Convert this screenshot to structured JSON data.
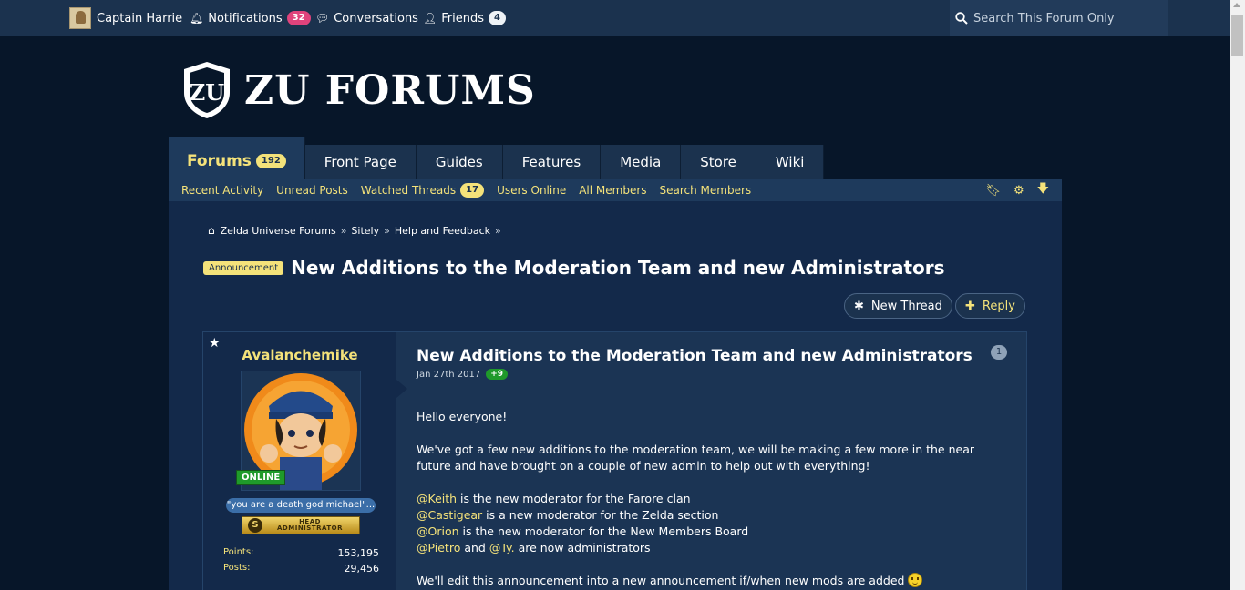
{
  "topbar": {
    "user": "Captain Harrie",
    "notifications_label": "Notifications",
    "notifications_count": "32",
    "conversations_label": "Conversations",
    "friends_label": "Friends",
    "friends_count": "4",
    "search_placeholder": "Search This Forum Only"
  },
  "logo": {
    "mark": "ZU",
    "text": "ZU FORUMS"
  },
  "nav": {
    "tabs": [
      {
        "label": "Forums",
        "count": "192"
      },
      {
        "label": "Front Page"
      },
      {
        "label": "Guides"
      },
      {
        "label": "Features"
      },
      {
        "label": "Media"
      },
      {
        "label": "Store"
      },
      {
        "label": "Wiki"
      }
    ],
    "sub": [
      {
        "label": "Recent Activity"
      },
      {
        "label": "Unread Posts"
      },
      {
        "label": "Watched Threads",
        "count": "17"
      },
      {
        "label": "Users Online"
      },
      {
        "label": "All Members"
      },
      {
        "label": "Search Members"
      }
    ]
  },
  "breadcrumb": [
    "Zelda Universe Forums",
    "Sitely",
    "Help and Feedback"
  ],
  "thread": {
    "prefix": "Announcement",
    "title": "New Additions to the Moderation Team and new Administrators",
    "new_thread_label": "New Thread",
    "reply_label": "Reply"
  },
  "post": {
    "author": "Avalanchemike",
    "online": "ONLINE",
    "user_title": "\"you are a death god michael\"...",
    "rank_line1": "HEAD",
    "rank_line2": "ADMINISTRATOR",
    "points_label": "Points:",
    "points_value": "153,195",
    "posts_label": "Posts:",
    "posts_value": "29,456",
    "title": "New Additions to the Moderation Team and new Administrators",
    "date": "Jan 27th 2017",
    "likes": "+9",
    "number": "1",
    "greeting": "Hello everyone!",
    "intro": "We've got a few new additions to the moderation team, we will be making a few more in the near future and have brought on a couple of new admin to help out with everything!",
    "lines": [
      {
        "mention": "@Keith",
        "text": " is the new moderator for the Farore clan"
      },
      {
        "mention": "@Castigear",
        "text": " is a new moderator for the Zelda section"
      },
      {
        "mention": "@Orion",
        "text": " is the new moderator for the New Members Board"
      }
    ],
    "admins_m1": "@Pietro",
    "admins_and": " and ",
    "admins_m2": "@Ty.",
    "admins_text": " are now administrators",
    "closing": "We'll edit this announcement into a new announcement if/when new mods are added"
  }
}
